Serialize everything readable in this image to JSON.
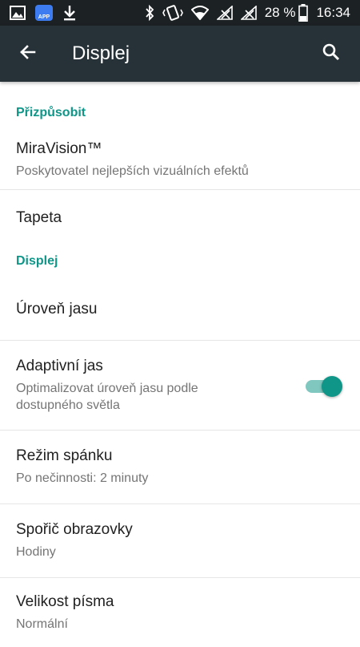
{
  "status_bar": {
    "battery_text": "28 %",
    "time": "16:34",
    "app_badge_label": "APP"
  },
  "app_bar": {
    "title": "Displej"
  },
  "sections": [
    {
      "header": "Přizpůsobit",
      "items": [
        {
          "title": "MiraVision™",
          "subtitle": "Poskytovatel nejlepších vizuálních efektů"
        },
        {
          "title": "Tapeta"
        }
      ]
    },
    {
      "header": "Displej",
      "items": [
        {
          "title": "Úroveň jasu"
        },
        {
          "title": "Adaptivní jas",
          "subtitle": "Optimalizovat úroveň jasu podle dostupného světla",
          "toggle_on": true
        },
        {
          "title": "Režim spánku",
          "subtitle": "Po nečinnosti: 2 minuty"
        },
        {
          "title": "Spořič obrazovky",
          "subtitle": "Hodiny"
        },
        {
          "title": "Velikost písma",
          "subtitle": "Normální"
        }
      ]
    }
  ],
  "colors": {
    "accent": "#0f9688",
    "app_bar": "#263238",
    "status_bar": "#1c2124"
  }
}
